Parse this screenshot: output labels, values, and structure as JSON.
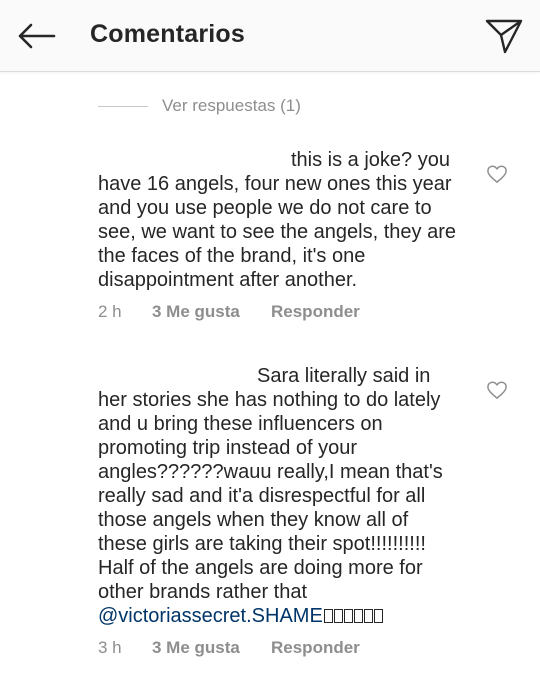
{
  "header": {
    "title": "Comentarios",
    "back_icon": "arrow-left-icon",
    "share_icon": "paper-plane-icon"
  },
  "replies": {
    "label": "Ver respuestas (1)"
  },
  "comments": [
    {
      "text": "this is a joke? you\nhave 16 angels, four new ones this year\nand you use people we do not care to\nsee, we want to see the angels, they are\nthe faces of the brand, it's one\ndisappointment after another.",
      "time": "2 h",
      "likes": "3 Me gusta",
      "reply": "Responder"
    },
    {
      "text": "Sara literally said in\nher stories she has nothing to do lately\nand u bring these influencers on\npromoting trip instead of your\nangles??????wauu really,I mean that's\nreally sad and it'a disrespectful for all\nthose angels when they know all of\nthese girls are taking their spot!!!!!!!!!!\nHalf of the angels are doing more for\nother brands rather that",
      "mention": "@victoriassecret.SHAME",
      "time": "3 h",
      "likes": "3 Me gusta",
      "reply": "Responder"
    }
  ],
  "colors": {
    "text": "#262626",
    "secondary": "#8e8e8e",
    "mention": "#003569",
    "header_bg": "#fafafa"
  }
}
